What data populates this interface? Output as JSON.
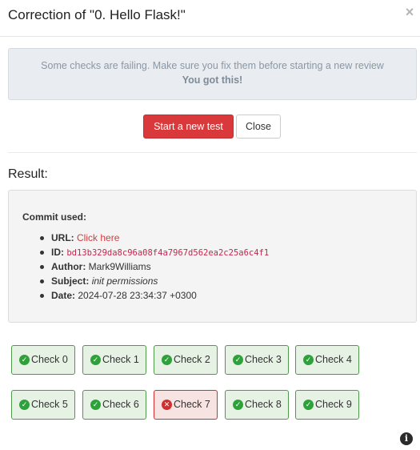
{
  "modal": {
    "title": "Correction of \"0. Hello Flask!\"",
    "close_glyph": "×"
  },
  "alert": {
    "message": "Some checks are failing. Make sure you fix them before starting a new review",
    "encouragement": "You got this!"
  },
  "actions": {
    "start_label": "Start a new test",
    "close_label": "Close"
  },
  "result": {
    "heading": "Result:",
    "commit_heading": "Commit used:",
    "url_key": "URL:",
    "url_value": "Click here",
    "id_key": "ID:",
    "id_value": "bd13b329da8c96a08f4a7967d562ea2c25a6c4f1",
    "author_key": "Author:",
    "author_value": "Mark9Williams",
    "subject_key": "Subject:",
    "subject_value": "init permissions",
    "date_key": "Date:",
    "date_value": "2024-07-28 23:34:37 +0300"
  },
  "checks": [
    {
      "label": "Check 0",
      "status": "pass",
      "glyph": "✓"
    },
    {
      "label": "Check 1",
      "status": "pass",
      "glyph": "✓"
    },
    {
      "label": "Check 2",
      "status": "pass",
      "glyph": "✓"
    },
    {
      "label": "Check 3",
      "status": "pass",
      "glyph": "✓"
    },
    {
      "label": "Check 4",
      "status": "pass",
      "glyph": "✓"
    },
    {
      "label": "Check 5",
      "status": "pass",
      "glyph": "✓"
    },
    {
      "label": "Check 6",
      "status": "pass",
      "glyph": "✓"
    },
    {
      "label": "Check 7",
      "status": "fail",
      "glyph": "✕"
    },
    {
      "label": "Check 8",
      "status": "pass",
      "glyph": "✓"
    },
    {
      "label": "Check 9",
      "status": "pass",
      "glyph": "✓"
    }
  ],
  "info_glyph": "i",
  "colors": {
    "accent": "#d9393b",
    "pass_border": "#4f9a4a",
    "pass_bg": "#e6f2e4",
    "fail_border": "#d32e2e",
    "fail_bg": "#f8e3e3"
  }
}
